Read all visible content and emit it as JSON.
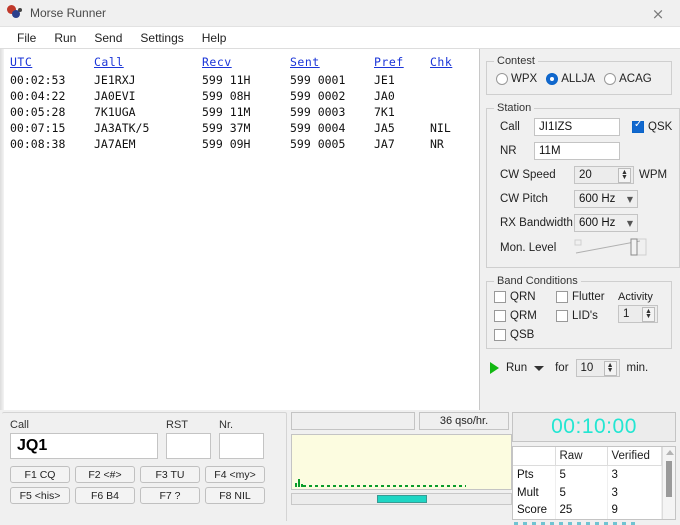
{
  "window": {
    "title": "Morse Runner",
    "close_label": "×",
    "app_icon": "morse-runner-icon"
  },
  "menu": {
    "items": [
      "File",
      "Run",
      "Send",
      "Settings",
      "Help"
    ]
  },
  "log": {
    "columns": [
      "UTC",
      "Call",
      "Recv",
      "Sent",
      "Pref",
      "Chk"
    ],
    "rows": [
      {
        "utc": "00:02:53",
        "call": "JE1RXJ",
        "recv": "599 11H",
        "sent": "599 0001",
        "pref": "JE1",
        "chk": ""
      },
      {
        "utc": "00:04:22",
        "call": "JA0EVI",
        "recv": "599 08H",
        "sent": "599 0002",
        "pref": "JA0",
        "chk": ""
      },
      {
        "utc": "00:05:28",
        "call": "7K1UGA",
        "recv": "599 11M",
        "sent": "599 0003",
        "pref": "7K1",
        "chk": ""
      },
      {
        "utc": "00:07:15",
        "call": "JA3ATK/5",
        "recv": "599 37M",
        "sent": "599 0004",
        "pref": "JA5",
        "chk": "NIL"
      },
      {
        "utc": "00:08:38",
        "call": "JA7AEM",
        "recv": "599 09H",
        "sent": "599 0005",
        "pref": "JA7",
        "chk": "NR"
      }
    ]
  },
  "contest": {
    "legend": "Contest",
    "options": [
      "WPX",
      "ALLJA",
      "ACAG"
    ],
    "selected": "ALLJA"
  },
  "station": {
    "legend": "Station",
    "call_label": "Call",
    "call_value": "JI1IZS",
    "qsk_label": "QSK",
    "qsk_checked": true,
    "nr_label": "NR",
    "nr_value": "11M",
    "cw_speed_label": "CW Speed",
    "cw_speed_value": "20",
    "cw_speed_unit": "WPM",
    "cw_pitch_label": "CW Pitch",
    "cw_pitch_value": "600 Hz",
    "rx_bandwidth_label": "RX Bandwidth",
    "rx_bandwidth_value": "600 Hz",
    "mon_level_label": "Mon. Level"
  },
  "band_conditions": {
    "legend": "Band Conditions",
    "qrn_label": "QRN",
    "qrm_label": "QRM",
    "qsb_label": "QSB",
    "flutter_label": "Flutter",
    "lids_label": "LID's",
    "qrn_checked": false,
    "qrm_checked": false,
    "qsb_checked": false,
    "flutter_checked": false,
    "lids_checked": false,
    "activity_label": "Activity",
    "activity_value": "1"
  },
  "run": {
    "button_label": "Run",
    "for_label": "for",
    "minutes_value": "10",
    "minutes_unit": "min."
  },
  "entry": {
    "call_label": "Call",
    "call_value": "JQ1",
    "rst_label": "RST",
    "rst_value": "",
    "nr_label": "Nr.",
    "nr_value": "",
    "function_keys": [
      [
        "F1 CQ",
        "F2 <#>",
        "F3 TU",
        "F4 <my>"
      ],
      [
        "F5 <his>",
        "F6 B4",
        "F7 ?",
        "F8 NIL"
      ]
    ]
  },
  "status": {
    "message": "",
    "rate": "36 qso/hr."
  },
  "timer": {
    "value": "00:10:00",
    "color": "#23e6d2"
  },
  "score": {
    "columns": [
      "",
      "Raw",
      "Verified"
    ],
    "rows": [
      {
        "label": "Pts",
        "raw": "5",
        "verified": "3"
      },
      {
        "label": "Mult",
        "raw": "5",
        "verified": "3"
      },
      {
        "label": "Score",
        "raw": "25",
        "verified": "9"
      }
    ]
  }
}
